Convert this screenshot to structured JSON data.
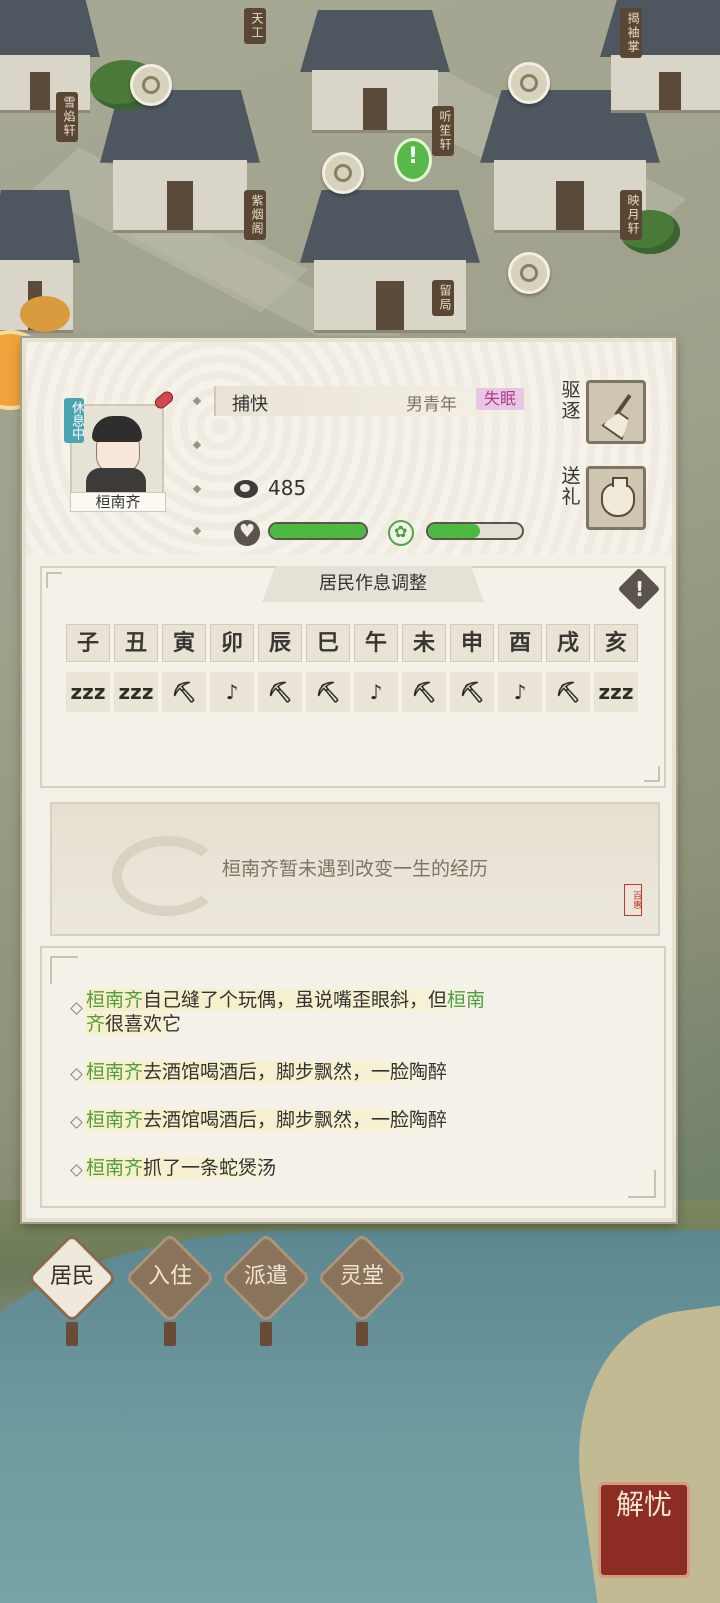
{
  "scene": {
    "signs": [
      "雪焰轩",
      "天工",
      "紫烟阁",
      "听笙轩",
      "留局",
      "揭袖掌",
      "映月轩"
    ]
  },
  "resident": {
    "status_badge": "休息中",
    "name": "桓南齐",
    "job": "捕快",
    "gender_age": "男青年",
    "trait": "失眠",
    "coins": "485",
    "health_level": 1.0,
    "mood_level": 0.55
  },
  "actions": {
    "expel_label": "驱逐",
    "gift_label": "送礼",
    "expel_icon": "broom-icon",
    "gift_icon": "gift-bag-icon"
  },
  "schedule": {
    "title": "居民作息调整",
    "hours": [
      "子",
      "丑",
      "寅",
      "卯",
      "辰",
      "巳",
      "午",
      "未",
      "申",
      "酉",
      "戌",
      "亥"
    ],
    "activities": [
      "zzz",
      "zzz",
      "⛏",
      "♪",
      "⛏",
      "⛏",
      "♪",
      "⛏",
      "⛏",
      "♪",
      "⛏",
      "zzz"
    ]
  },
  "life_event": {
    "text": "桓南齐暂未遇到改变一生的经历",
    "seal": "百惠"
  },
  "log": {
    "items": [
      {
        "name": "桓南齐",
        "text": "自己缝了个玩偶，虽说嘴歪眼斜，但",
        "name2": "桓南",
        "line2_name": "齐",
        "line2_text": "很喜欢它"
      },
      {
        "name": "桓南齐",
        "text": "去酒馆喝酒后，脚步飘然，一脸陶醉"
      },
      {
        "name": "桓南齐",
        "text": "去酒馆喝酒后，脚步飘然，一脸陶醉"
      },
      {
        "name": "桓南齐",
        "text": "抓了一条蛇煲汤"
      }
    ]
  },
  "tabs": [
    {
      "label": "居民",
      "active": true
    },
    {
      "label": "入住",
      "active": false
    },
    {
      "label": "派遣",
      "active": false
    },
    {
      "label": "灵堂",
      "active": false
    }
  ],
  "corner_seal": "解忧",
  "colors": {
    "accent_green": "#4cb940",
    "name_green": "#4e9d3f",
    "trait_pink": "#b03d8c",
    "tab_brown": "#8d7258"
  }
}
